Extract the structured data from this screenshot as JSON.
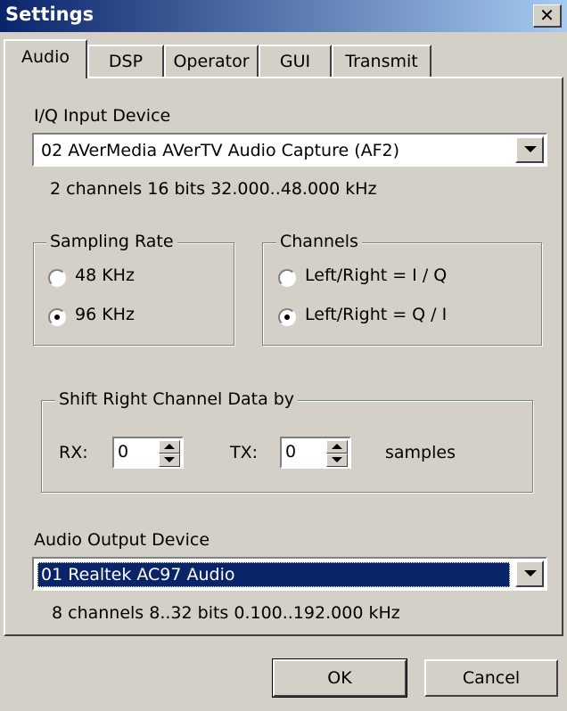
{
  "window": {
    "title": "Settings",
    "close_glyph": "✕"
  },
  "tabs": [
    {
      "label": "Audio",
      "active": true
    },
    {
      "label": "DSP",
      "active": false
    },
    {
      "label": "Operator",
      "active": false
    },
    {
      "label": "GUI",
      "active": false
    },
    {
      "label": "Transmit",
      "active": false
    }
  ],
  "iq_input": {
    "label": "I/Q Input Device",
    "selected": "02  AVerMedia AVerTV Audio Capture (AF2)",
    "info": "2 channels  16 bits  32.000..48.000 kHz"
  },
  "sampling_rate": {
    "title": "Sampling Rate",
    "options": [
      {
        "label": "48 KHz",
        "checked": false
      },
      {
        "label": "96 KHz",
        "checked": true
      }
    ]
  },
  "channels": {
    "title": "Channels",
    "options": [
      {
        "label": "Left/Right = I / Q",
        "checked": false
      },
      {
        "label": "Left/Right = Q / I",
        "checked": true
      }
    ]
  },
  "shift": {
    "title": "Shift Right Channel Data by",
    "rx_label": "RX:",
    "rx_value": "0",
    "tx_label": "TX:",
    "tx_value": "0",
    "unit": "samples"
  },
  "audio_output": {
    "label": "Audio Output Device",
    "selected": "01  Realtek AC97 Audio",
    "info": "8 channels  8..32 bits  0.100..192.000 kHz"
  },
  "buttons": {
    "ok": "OK",
    "cancel": "Cancel"
  }
}
